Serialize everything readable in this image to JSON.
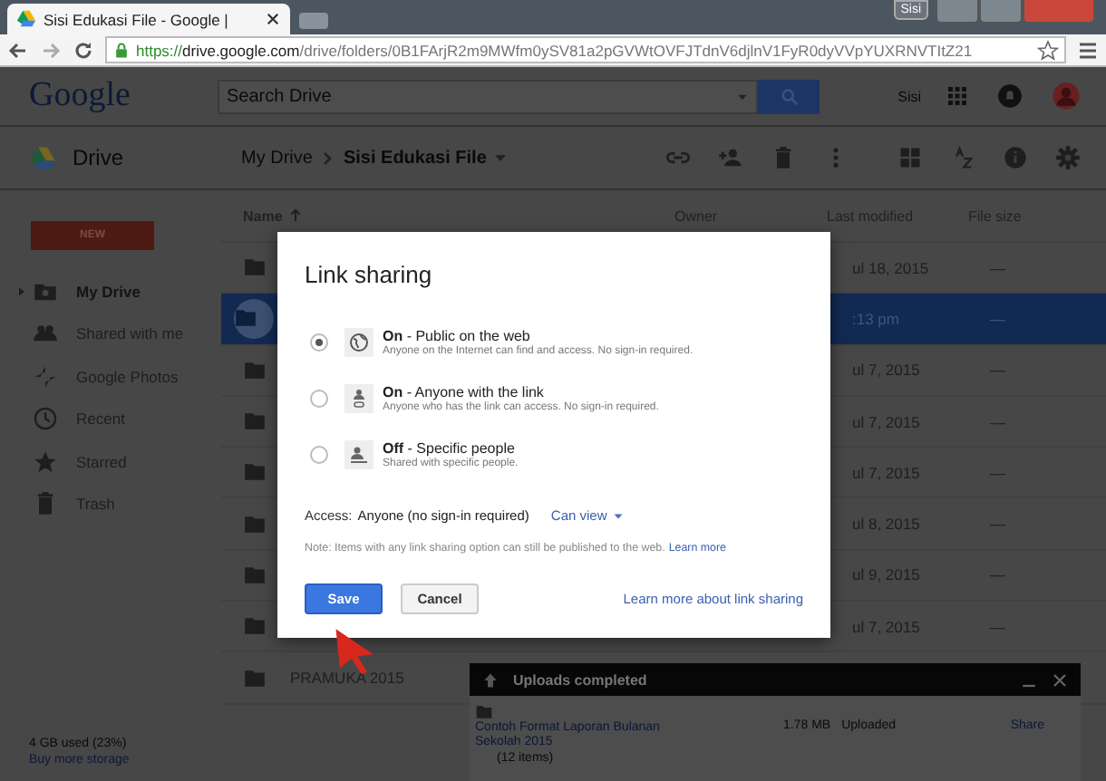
{
  "browser": {
    "tab_title": "Sisi Edukasi File - Google |",
    "profile": "Sisi",
    "url_scheme": "https://",
    "url_host": "drive.google.com",
    "url_path": "/drive/folders/0B1FArjR2m9MWfm0ySV81a2pGVWtOVFJTdnV6djlnV1FyR0dyVVpYUXRNVTItZ21"
  },
  "header": {
    "logo": "Google",
    "search_placeholder": "Search Drive",
    "user": "Sisi"
  },
  "toolbar": {
    "app": "Drive",
    "breadcrumb": [
      {
        "label": "My Drive",
        "current": false
      },
      {
        "label": "Sisi Edukasi File",
        "current": true
      }
    ]
  },
  "sidebar": {
    "new_button": "NEW",
    "items": [
      {
        "label": "My Drive",
        "kind": "drive",
        "selected": true
      },
      {
        "label": "Shared with me",
        "kind": "shared",
        "selected": false
      },
      {
        "label": "Google Photos",
        "kind": "photos",
        "selected": false
      },
      {
        "label": "Recent",
        "kind": "recent",
        "selected": false
      },
      {
        "label": "Starred",
        "kind": "starred",
        "selected": false
      },
      {
        "label": "Trash",
        "kind": "trash",
        "selected": false
      }
    ],
    "storage": "4 GB used (23%)",
    "buy_storage": "Buy more storage"
  },
  "file_list": {
    "columns": [
      "Name",
      "Owner",
      "Last modified",
      "File size"
    ],
    "rows": [
      {
        "modified": "ul 18, 2015",
        "size": "—",
        "selected": false
      },
      {
        "modified": ":13 pm",
        "size": "—",
        "selected": true
      },
      {
        "modified": "ul 7, 2015",
        "size": "—",
        "selected": false
      },
      {
        "modified": "ul 7, 2015",
        "size": "—",
        "selected": false
      },
      {
        "modified": "ul 7, 2015",
        "size": "—",
        "selected": false
      },
      {
        "modified": "ul 8, 2015",
        "size": "—",
        "selected": false
      },
      {
        "modified": "ul 9, 2015",
        "size": "—",
        "selected": false
      },
      {
        "modified": "ul 7, 2015",
        "size": "—",
        "selected": false
      },
      {
        "name": "PRAMUKA 2015",
        "selected": false
      }
    ]
  },
  "dialog": {
    "title": "Link sharing",
    "options": [
      {
        "kind": "public",
        "label": "**On** - Public on the web",
        "description": "Anyone on the Internet can find and access. No sign-in required.",
        "selected": true
      },
      {
        "kind": "link",
        "label": "**On** - Anyone with the link",
        "description": "Anyone who has the link can access. No sign-in required.",
        "selected": false
      },
      {
        "kind": "private",
        "label": "**Off** - Specific people",
        "description": "Shared with specific people.",
        "selected": false
      }
    ],
    "access_label": "Access:",
    "access_value": "Anyone (no sign-in required)",
    "permission": "Can view",
    "note": "Note: Items with any link sharing option can still be published to the web.",
    "note_link": "Learn more",
    "save": "Save",
    "cancel": "Cancel",
    "learn_link": "Learn more about link sharing"
  },
  "uploads": {
    "title": "Uploads completed",
    "items": [
      {
        "name": "Contoh Format Laporan Bulanan Sekolah 2015",
        "count": "(12 items)",
        "size": "1.78 MB",
        "status": "Uploaded",
        "action": "Share"
      }
    ]
  }
}
